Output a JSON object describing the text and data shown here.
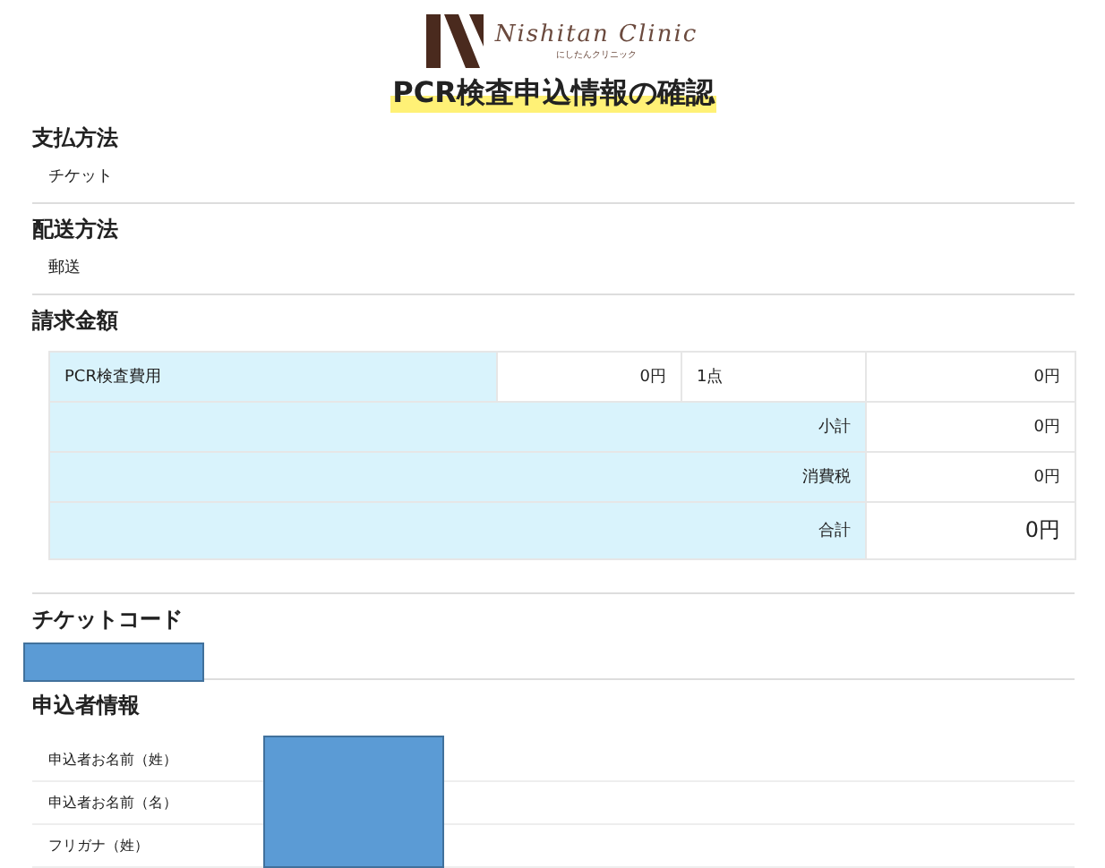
{
  "logo": {
    "name": "Nishitan Clinic",
    "kana": "にしたんクリニック"
  },
  "title": "PCR検査申込情報の確認",
  "payment": {
    "heading": "支払方法",
    "value": "チケット"
  },
  "delivery": {
    "heading": "配送方法",
    "value": "郵送"
  },
  "billing": {
    "heading": "請求金額",
    "item": {
      "name": "PCR検査費用",
      "price": "0円",
      "quantity": "1点",
      "amount": "0円"
    },
    "totals": [
      {
        "label": "小計",
        "amount": "0円",
        "kind": "normal"
      },
      {
        "label": "消費税",
        "amount": "0円",
        "kind": "normal"
      },
      {
        "label": "合計",
        "amount": "0円",
        "kind": "grand"
      }
    ]
  },
  "ticket_code": {
    "heading": "チケットコード"
  },
  "applicant": {
    "heading": "申込者情報",
    "fields": [
      {
        "label": "申込者お名前（姓）"
      },
      {
        "label": "申込者お名前（名）"
      },
      {
        "label": "フリガナ（姓）"
      }
    ]
  }
}
